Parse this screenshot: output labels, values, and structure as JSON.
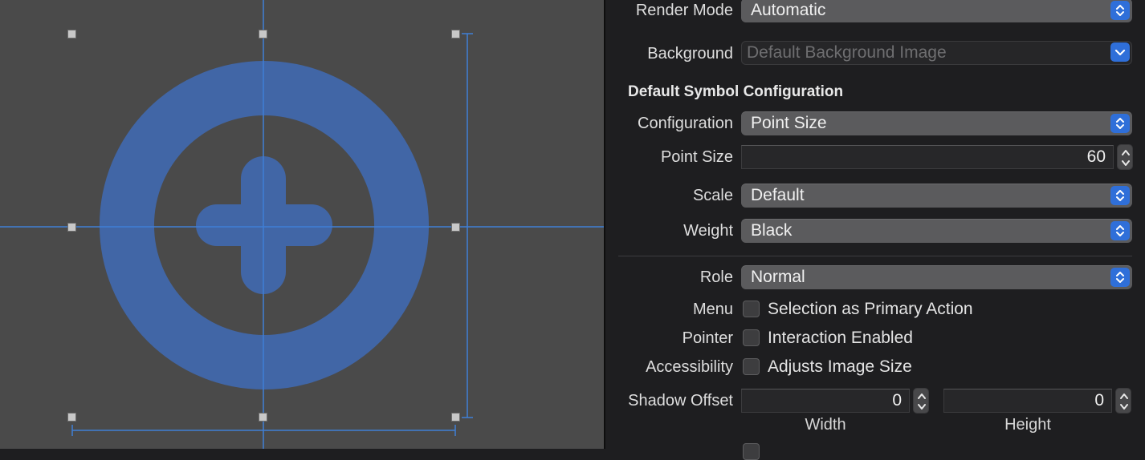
{
  "canvas": {
    "symbol_color": "#4166a6",
    "guide_color": "#3f7fd6",
    "icon": "plus-circle-symbol"
  },
  "inspector": {
    "render_mode": {
      "label": "Render Mode",
      "value": "Automatic"
    },
    "background": {
      "label": "Background",
      "placeholder": "Default Background Image"
    },
    "symbol_section": {
      "heading": "Default Symbol Configuration"
    },
    "configuration": {
      "label": "Configuration",
      "value": "Point Size"
    },
    "point_size": {
      "label": "Point Size",
      "value": "60"
    },
    "scale": {
      "label": "Scale",
      "value": "Default"
    },
    "weight": {
      "label": "Weight",
      "value": "Black"
    },
    "role": {
      "label": "Role",
      "value": "Normal"
    },
    "menu": {
      "label": "Menu",
      "checkbox_text": "Selection as Primary Action",
      "checked": false
    },
    "pointer": {
      "label": "Pointer",
      "checkbox_text": "Interaction Enabled",
      "checked": false
    },
    "accessibility": {
      "label": "Accessibility",
      "checkbox_text": "Adjusts Image Size",
      "checked": false
    },
    "shadow_offset": {
      "label": "Shadow Offset",
      "width_value": "0",
      "width_label": "Width",
      "height_value": "0",
      "height_label": "Height"
    }
  },
  "colors": {
    "accent": "#2f6fd9",
    "canvas_bg": "#4a4a4a",
    "inspector_bg": "#1e1e20"
  }
}
